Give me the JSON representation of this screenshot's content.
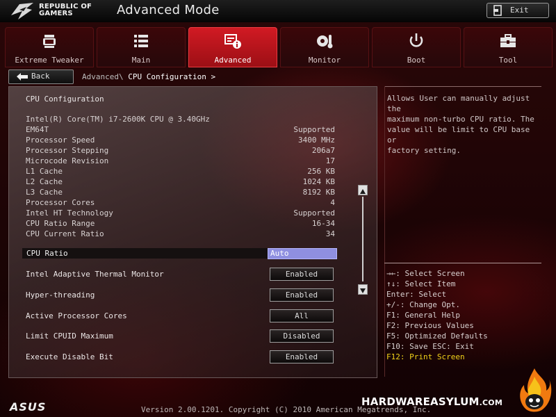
{
  "header": {
    "logo_line1": "REPUBLIC OF",
    "logo_line2": "GAMERS",
    "title": "Advanced Mode",
    "exit_label": "Exit"
  },
  "tabs": [
    {
      "label": "Extreme Tweaker",
      "icon": "cpu-fan-icon"
    },
    {
      "label": "Main",
      "icon": "list-icon"
    },
    {
      "label": "Advanced",
      "icon": "advanced-info-icon",
      "active": true
    },
    {
      "label": "Monitor",
      "icon": "gear-thermometer-icon"
    },
    {
      "label": "Boot",
      "icon": "power-icon"
    },
    {
      "label": "Tool",
      "icon": "toolbox-icon"
    }
  ],
  "nav": {
    "back_label": "Back",
    "breadcrumb_parent": "Advanced\\",
    "breadcrumb_current": "CPU Configuration >"
  },
  "panel": {
    "title": "CPU Configuration",
    "cpu_name": "Intel(R) Core(TM) i7-2600K CPU @ 3.40GHz",
    "info": [
      {
        "label": "EM64T",
        "value": "Supported"
      },
      {
        "label": "Processor Speed",
        "value": "3400 MHz"
      },
      {
        "label": "Processor Stepping",
        "value": "206a7"
      },
      {
        "label": "Microcode Revision",
        "value": "17"
      },
      {
        "label": "L1 Cache",
        "value": "256 KB"
      },
      {
        "label": "L2 Cache",
        "value": "1024 KB"
      },
      {
        "label": "L3 Cache",
        "value": "8192 KB"
      },
      {
        "label": "Processor Cores",
        "value": "4"
      },
      {
        "label": "Intel HT Technology",
        "value": "Supported"
      },
      {
        "label": "CPU Ratio Range",
        "value": "16-34"
      },
      {
        "label": "CPU Current Ratio",
        "value": "34"
      }
    ],
    "cpu_ratio": {
      "label": "CPU Ratio",
      "value": "Auto"
    },
    "options": [
      {
        "label": "Intel Adaptive Thermal Monitor",
        "value": "Enabled"
      },
      {
        "label": "Hyper-threading",
        "value": "Enabled"
      },
      {
        "label": "Active Processor Cores",
        "value": "All"
      },
      {
        "label": "Limit CPUID Maximum",
        "value": "Disabled"
      },
      {
        "label": "Execute Disable Bit",
        "value": "Enabled"
      }
    ]
  },
  "help": {
    "lines": [
      "Allows User can manually adjust the",
      "maximum non-turbo CPU ratio. The",
      "value will be limit to CPU base or",
      "factory setting."
    ],
    "keys": [
      "→←: Select Screen",
      "↑↓: Select Item",
      "Enter: Select",
      "+/-: Change Opt.",
      "F1: General Help",
      "F2: Previous Values",
      "F5: Optimized Defaults",
      "F10: Save  ESC: Exit",
      "F12: Print Screen"
    ]
  },
  "footer": {
    "brand": "ASUS",
    "version": "Version 2.00.1201. Copyright (C) 2010 American Megatrends, Inc.",
    "watermark_main": "HARDWAREASYLUM",
    "watermark_suffix": ".COM"
  },
  "colors": {
    "accent": "#c8141c",
    "highlight_key": "#f2d21a",
    "selected_value_bg": "#8f8fe0"
  }
}
